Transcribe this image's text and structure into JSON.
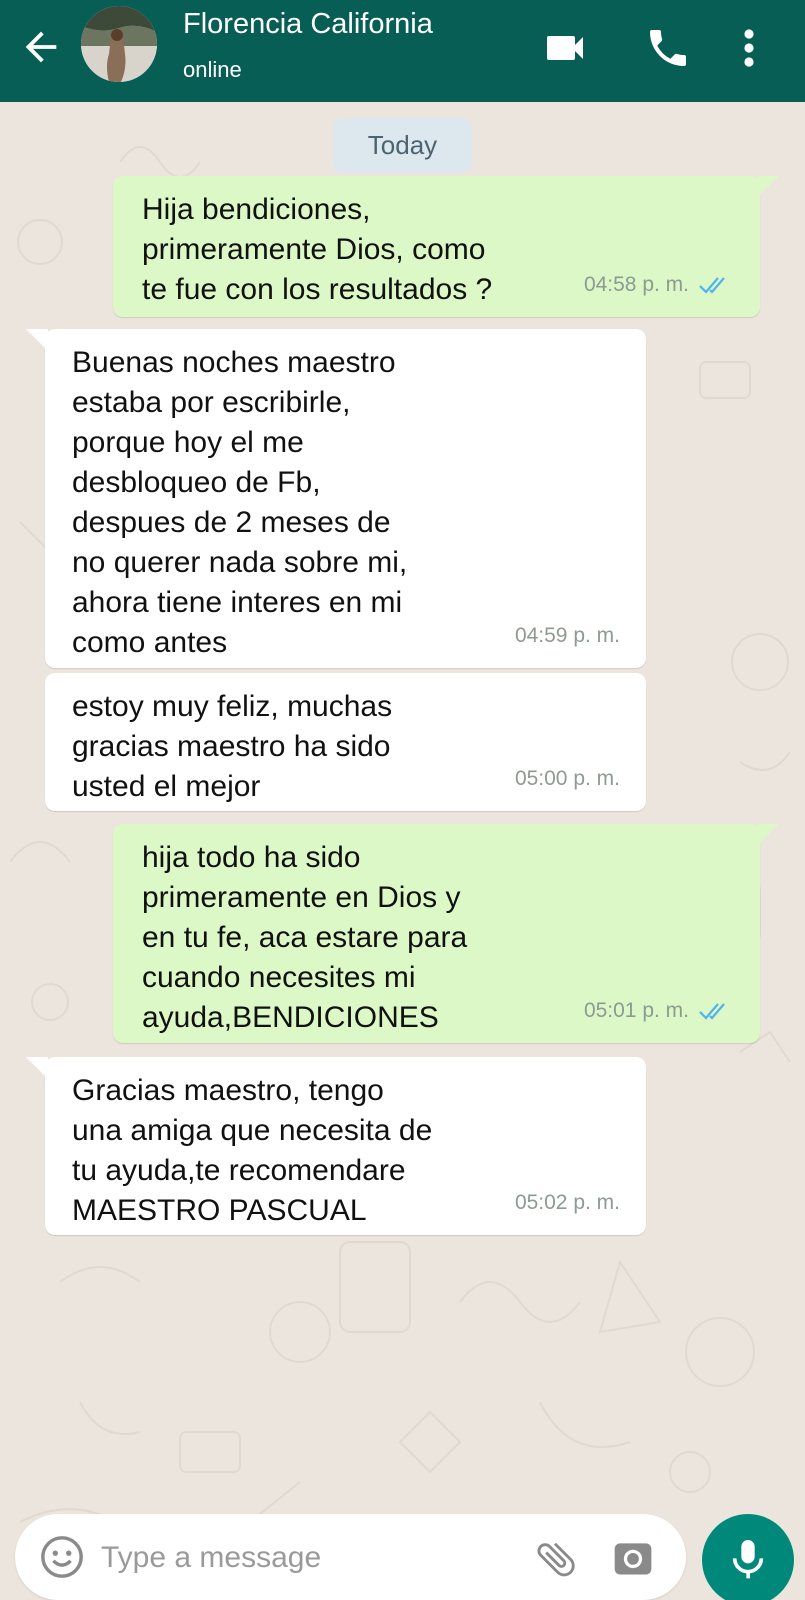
{
  "header": {
    "contact_name": "Florencia California",
    "status": "online",
    "icons": [
      "back-arrow-icon",
      "video-call-icon",
      "phone-icon",
      "more-options-icon"
    ]
  },
  "chat": {
    "date_label": "Today",
    "messages": [
      {
        "direction": "outgoing",
        "text": "Hija bendiciones,\nprimeramente  Dios, como\nte fue con los resultados ?",
        "time": "04:58 p. m.",
        "read": true
      },
      {
        "direction": "incoming",
        "text": "Buenas noches maestro\nestaba por escribirle,\nporque hoy el me\ndesbloqueo de Fb,\ndespues de 2 meses de\nno querer nada sobre mi,\nahora tiene interes en mi\ncomo antes",
        "time": "04:59 p. m."
      },
      {
        "direction": "incoming",
        "text": "estoy muy feliz, muchas\ngracias maestro ha sido\nusted el mejor",
        "time": "05:00 p. m."
      },
      {
        "direction": "outgoing",
        "text": "hija todo ha sido\nprimeramente en Dios y\nen tu fe, aca estare para\ncuando necesites mi\nayuda,BENDICIONES",
        "time": "05:01 p. m.",
        "read": true
      },
      {
        "direction": "incoming",
        "text": "Gracias maestro, tengo\nuna amiga que necesita de\ntu ayuda,te  recomendare\nMAESTRO PASCUAL",
        "time": "05:02 p. m."
      }
    ]
  },
  "composer": {
    "placeholder": "Type a message",
    "icons": [
      "emoji-icon",
      "attachment-icon",
      "camera-icon",
      "microphone-icon"
    ]
  },
  "colors": {
    "header_bg": "#075e54",
    "outgoing_bubble": "#dcf8c6",
    "incoming_bubble": "#ffffff",
    "read_ticks": "#4fb3f0",
    "mic_button": "#00897b",
    "chat_bg": "#ece5dd"
  }
}
